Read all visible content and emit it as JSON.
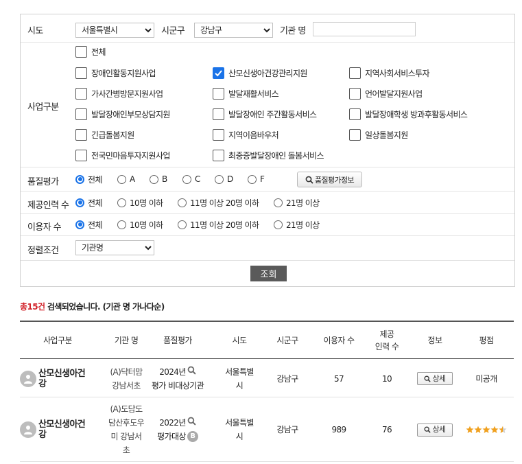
{
  "filter": {
    "sido": {
      "label": "시도",
      "value": "서울특별시"
    },
    "sigungu": {
      "label": "시군구",
      "value": "강남구"
    },
    "agency": {
      "label": "기관 명",
      "value": ""
    },
    "business": {
      "label": "사업구분",
      "items": [
        {
          "label": "전체",
          "checked": false
        },
        {
          "label": "장애인활동지원사업",
          "checked": false
        },
        {
          "label": "산모신생아건강관리지원",
          "checked": true
        },
        {
          "label": "지역사회서비스투자",
          "checked": false
        },
        {
          "label": "가사간병방문지원사업",
          "checked": false
        },
        {
          "label": "발달재활서비스",
          "checked": false
        },
        {
          "label": "언어발달지원사업",
          "checked": false
        },
        {
          "label": "발달장애인부모상담지원",
          "checked": false
        },
        {
          "label": "발달장애인 주간활동서비스",
          "checked": false
        },
        {
          "label": "발달장애학생 방과후활동서비스",
          "checked": false
        },
        {
          "label": "긴급돌봄지원",
          "checked": false
        },
        {
          "label": "지역이음바우처",
          "checked": false
        },
        {
          "label": "일상돌봄지원",
          "checked": false
        },
        {
          "label": "전국민마음투자지원사업",
          "checked": false
        },
        {
          "label": "최중증발달장애인 돌봄서비스",
          "checked": false
        }
      ]
    },
    "quality": {
      "label": "품질평가",
      "options": [
        {
          "label": "전체",
          "selected": true
        },
        {
          "label": "A",
          "selected": false
        },
        {
          "label": "B",
          "selected": false
        },
        {
          "label": "C",
          "selected": false
        },
        {
          "label": "D",
          "selected": false
        },
        {
          "label": "F",
          "selected": false
        }
      ],
      "info_button": "품질평가정보"
    },
    "staff": {
      "label": "제공인력 수",
      "options": [
        {
          "label": "전체",
          "selected": true
        },
        {
          "label": "10명 이하",
          "selected": false
        },
        {
          "label": "11명 이상 20명 이하",
          "selected": false
        },
        {
          "label": "21명 이상",
          "selected": false
        }
      ]
    },
    "users": {
      "label": "이용자 수",
      "options": [
        {
          "label": "전체",
          "selected": true
        },
        {
          "label": "10명 이하",
          "selected": false
        },
        {
          "label": "11명 이상 20명 이하",
          "selected": false
        },
        {
          "label": "21명 이상",
          "selected": false
        }
      ]
    },
    "sort": {
      "label": "정렬조건",
      "value": "기관명"
    },
    "search_button": "조회"
  },
  "result": {
    "count_text": "총15건",
    "summary_text": " 검색되었습니다. (기관 명 가나다순)"
  },
  "table": {
    "headers": [
      "사업구분",
      "기관 명",
      "품질평가",
      "시도",
      "시군구",
      "이용자 수",
      "제공\n인력 수",
      "정보",
      "평점"
    ],
    "rows": [
      {
        "business": "산모신생아건강",
        "agency": "(A)닥터맘\n강남서초",
        "quality_year": "2024년",
        "quality_status": "평가 비대상기관",
        "quality_grade": "",
        "sido": "서울특별\n시",
        "sigungu": "강남구",
        "users": "57",
        "staff": "10",
        "info_button": "상세",
        "rating_text": "미공개",
        "rating_stars": null
      },
      {
        "business": "산모신생아건강",
        "agency": "(A)도담도\n담산후도우\n미 강남서\n초",
        "quality_year": "2022년",
        "quality_status": "평가대상",
        "quality_grade": "B",
        "sido": "서울특별\n시",
        "sigungu": "강남구",
        "users": "989",
        "staff": "76",
        "info_button": "상세",
        "rating_text": "",
        "rating_stars": 4.5
      }
    ]
  },
  "colors": {
    "accent": "#1a73e8",
    "count_red": "#d2232a",
    "search_button_bg": "#5a5a5a",
    "star": "#f0a01e"
  },
  "icons": [
    "checkmark-icon",
    "magnifier-icon",
    "person-avatar-icon",
    "star-icon",
    "chevron-down-icon"
  ]
}
